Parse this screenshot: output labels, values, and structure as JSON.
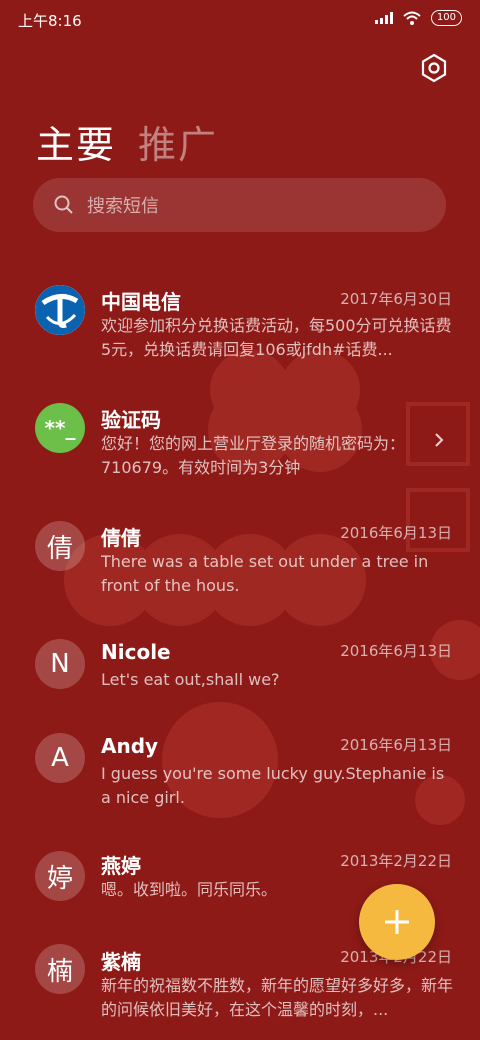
{
  "status_bar": {
    "time": "上午8:16",
    "battery": "100"
  },
  "tabs": [
    {
      "label": "主要",
      "active": true
    },
    {
      "label": "推广",
      "active": false
    }
  ],
  "search": {
    "placeholder": "搜索短信"
  },
  "messages": [
    {
      "sender": "中国电信",
      "date": "2017年6月30日",
      "preview": "欢迎参加积分兑换话费活动，每500分可兑换话费5元，兑换话费请回复106或jfdh#话费...",
      "avatar": "china-telecom-logo"
    },
    {
      "sender": "验证码",
      "date": "",
      "preview": "您好！您的网上营业厅登录的随机密码为：710679。有效时间为3分钟",
      "avatar_text": "**_",
      "avatar_color": "#6cc04a"
    },
    {
      "sender": "倩倩",
      "date": "2016年6月13日",
      "preview": "There was a table set out under a tree in front of the hous.",
      "avatar_text": "倩"
    },
    {
      "sender": "Nicole",
      "date": "2016年6月13日",
      "preview": "Let's eat out,shall we?",
      "avatar_text": "N"
    },
    {
      "sender": "Andy",
      "date": "2016年6月13日",
      "preview": "I guess you're some lucky guy.Stephanie is a nice girl.",
      "avatar_text": "A"
    },
    {
      "sender": "燕婷",
      "date": "2013年2月22日",
      "preview": "嗯。收到啦。同乐同乐。",
      "avatar_text": "婷"
    },
    {
      "sender": "紫楠",
      "date": "2013年2月22日",
      "preview": "新年的祝福数不胜数，新年的愿望好多好多，新年的问候依旧美好，在这个温馨的时刻，...",
      "avatar_text": "楠"
    }
  ],
  "colors": {
    "background": "#8e1a17",
    "fab": "#f6b93f",
    "verify_avatar": "#6cc04a"
  }
}
